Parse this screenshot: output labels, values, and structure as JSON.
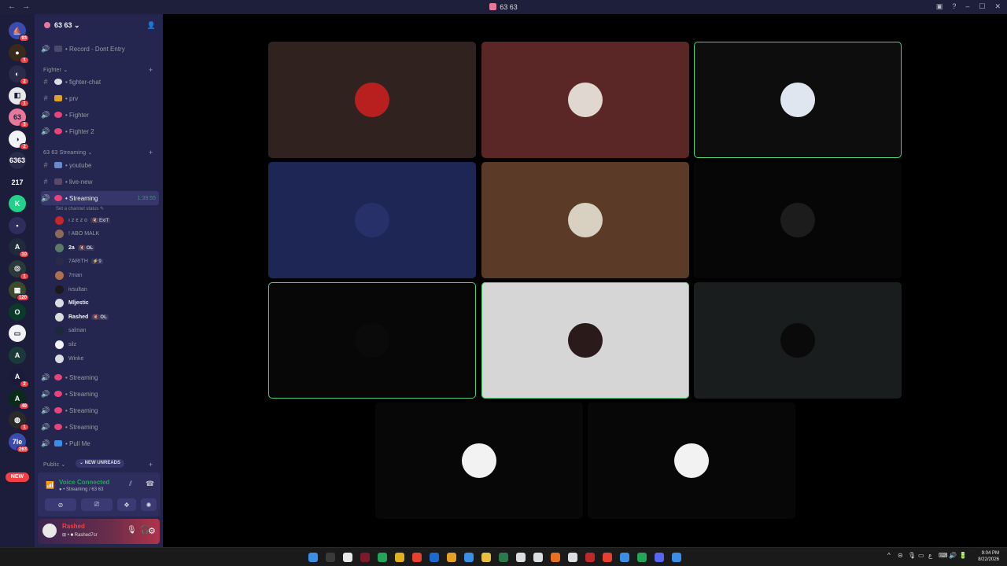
{
  "window": {
    "title": "63 63",
    "back": "←",
    "forward": "→",
    "inbox": "▣",
    "help": "?",
    "min": "–",
    "max": "☐",
    "close": "✕"
  },
  "rail": {
    "servers": [
      {
        "label": "⛵",
        "color": "#3b4bb0",
        "badge": "93"
      },
      {
        "label": "●",
        "color": "#3a2a1a",
        "badge": "1"
      },
      {
        "label": "◐",
        "color": "#2a2a4a",
        "badge": "2"
      },
      {
        "label": "◧",
        "color": "#e8e8e8",
        "badge": "1"
      },
      {
        "label": "63",
        "color": "#e8789a",
        "badge": "3"
      },
      {
        "label": "◑",
        "color": "#f2f3f5",
        "badge": "2"
      },
      {
        "label": "6363",
        "color": "#2a2a4a",
        "badge": ""
      },
      {
        "label": "217",
        "color": "#1c1c3b",
        "badge": ""
      },
      {
        "label": "K",
        "color": "#23d18b",
        "badge": ""
      },
      {
        "label": "▪",
        "color": "#2d2e5e",
        "badge": ""
      },
      {
        "label": "A",
        "color": "#1f2a3a",
        "badge": "10"
      },
      {
        "label": "◎",
        "color": "#2a3a3a",
        "badge": "1"
      },
      {
        "label": "▦",
        "color": "#3a4a2a",
        "badge": "120"
      },
      {
        "label": "O",
        "color": "#0a3a2a",
        "badge": ""
      },
      {
        "label": "▭",
        "color": "#f2f3f5",
        "badge": ""
      },
      {
        "label": "A",
        "color": "#1a3a3a",
        "badge": ""
      },
      {
        "label": "A",
        "color": "#1a1a3a",
        "badge": "2"
      },
      {
        "label": "A",
        "color": "#0a2a1a",
        "badge": "49"
      },
      {
        "label": "◍",
        "color": "#2a2a2a",
        "badge": "1"
      },
      {
        "label": "7le",
        "color": "#3b4bb0",
        "badge": "263"
      }
    ],
    "new_label": "NEW"
  },
  "server": {
    "name": "63 63",
    "chevron": "⌄",
    "add_user": "👤"
  },
  "channels": {
    "record": {
      "label": "• Record - Dont Entry",
      "icon": "🔊"
    },
    "cat_fighter": "Fighter ⌄",
    "fighter_chat": {
      "label": "• fighter-chat",
      "icon": "#"
    },
    "prv": {
      "label": "• prv",
      "icon": "#"
    },
    "fighter": {
      "label": "• Fighter",
      "icon": "🔊"
    },
    "fighter2": {
      "label": "• Fighter 2",
      "icon": "🔊"
    },
    "cat_streaming": "63 63 Streaming ⌄",
    "youtube": {
      "label": "• youtube",
      "icon": "#"
    },
    "live_new": {
      "label": "• live-new",
      "icon": "#"
    },
    "streaming": {
      "label": "• Streaming",
      "icon": "🔊",
      "timer": "1:39:55"
    },
    "set_status": "Set a channel status ✎",
    "streaming_b": {
      "label": "• Streaming",
      "icon": "🔊"
    },
    "streaming_c": {
      "label": "• Streaming",
      "icon": "🔊"
    },
    "streaming_d": {
      "label": "• Streaming",
      "icon": "🔊"
    },
    "streaming_e": {
      "label": "• Streaming",
      "icon": "🔊"
    },
    "pull_me": {
      "label": "• Pull Me",
      "icon": "🔊"
    },
    "cat_public": "Public ⌄",
    "new_unreads": "⌄ NEW UNREADS",
    "plus": "+"
  },
  "members": [
    {
      "name": "ı ᴢ ᴇ ᴢ ᴏ",
      "tag": "🔇 ExiT",
      "color": "#c0282a",
      "bright": false
    },
    {
      "name": "! ABO MALK",
      "tag": "",
      "color": "#8a6a5a",
      "bright": false
    },
    {
      "name": "2a",
      "tag": "🔇 OL",
      "color": "#5a7a6a",
      "bright": true
    },
    {
      "name": "7ARITH",
      "tag": "⚡9",
      "color": "#2a2a4a",
      "bright": false
    },
    {
      "name": "7man",
      "tag": "",
      "color": "#b07050",
      "bright": false
    },
    {
      "name": "ivsultan",
      "tag": "",
      "color": "#1a1a1a",
      "bright": false
    },
    {
      "name": "Mljestic",
      "tag": "",
      "color": "#dbdee1",
      "bright": true
    },
    {
      "name": "Rashed",
      "tag": "🔇 OL",
      "color": "#dbdee1",
      "bright": true
    },
    {
      "name": "salman",
      "tag": "",
      "color": "#1a2a3a",
      "bright": false
    },
    {
      "name": "silz",
      "tag": "",
      "color": "#f2f3f5",
      "bright": false
    },
    {
      "name": "Winke",
      "tag": "",
      "color": "#dbdee1",
      "bright": false
    }
  ],
  "voice": {
    "title": "Voice Connected",
    "sub": "● • Streaming / 63 63",
    "signal": "📶",
    "noise": "⫽",
    "disconnect": "☎",
    "btn_camera": "⊘",
    "btn_screen": "⎚",
    "btn_activity": "✥",
    "btn_soundboard": "✺"
  },
  "user": {
    "name": "Rashed",
    "status": "⊞ • ■ Rashed7cr",
    "mic": "🎙",
    "headset": "🎧",
    "settings": "⚙"
  },
  "tiles": [
    {
      "bg": "#2f221f",
      "av": "#b82020",
      "speaking": false
    },
    {
      "bg": "#5a2626",
      "av": "#e0d8d0",
      "speaking": false
    },
    {
      "bg": "#0c0d0c",
      "av": "#dfe6f0",
      "speaking": true
    },
    {
      "bg": "#1e2656",
      "av": "#28306a",
      "speaking": false
    },
    {
      "bg": "#5b3b28",
      "av": "#d8d0c0",
      "speaking": false
    },
    {
      "bg": "#060606",
      "av": "#1c1c1c",
      "speaking": false
    },
    {
      "bg": "#070707",
      "av": "#0a0a0a",
      "speaking": true
    },
    {
      "bg": "#d6d6d6",
      "av": "#2a1a1a",
      "speaking": true
    },
    {
      "bg": "#1a1d1d",
      "av": "#0a0a0a",
      "speaking": false
    },
    {
      "bg": "#070707",
      "av": "#f2f2f2",
      "speaking": false
    },
    {
      "bg": "#070707",
      "av": "#f2f2f2",
      "speaking": false
    }
  ],
  "taskbar": {
    "apps": [
      "#3a8ee6",
      "#3a3a3a",
      "#e8e8e8",
      "#7a1a2a",
      "#23a559",
      "#e0b020",
      "#e84030",
      "#1a6ad0",
      "#e8a020",
      "#3a8ee6",
      "#e8c040",
      "#2a7a4a",
      "#dbdee1",
      "#dbdee1",
      "#e87020",
      "#dbdee1",
      "#c0282a",
      "#e84030",
      "#3a8ee6",
      "#23a559",
      "#5865f2",
      "#3a8ee6"
    ],
    "tray": [
      "^",
      "⊝",
      "🎙",
      "▭",
      "ع",
      "⌨",
      "🔊",
      "🔋"
    ],
    "time": "9:04 PM",
    "date": "8/22/2026"
  }
}
